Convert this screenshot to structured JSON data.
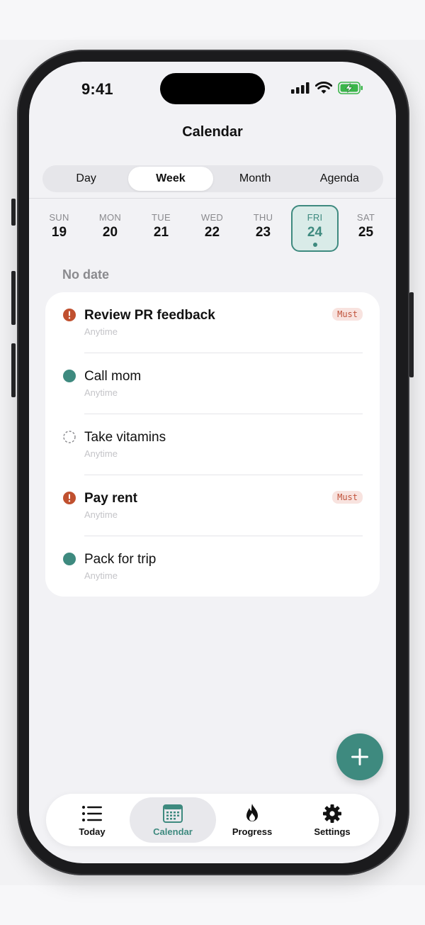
{
  "status_bar": {
    "time": "9:41"
  },
  "header": {
    "title": "Calendar"
  },
  "view_switcher": {
    "options": [
      "Day",
      "Week",
      "Month",
      "Agenda"
    ],
    "selected": "Week"
  },
  "week": {
    "days": [
      {
        "dow": "SUN",
        "num": "19"
      },
      {
        "dow": "MON",
        "num": "20"
      },
      {
        "dow": "TUE",
        "num": "21"
      },
      {
        "dow": "WED",
        "num": "22"
      },
      {
        "dow": "THU",
        "num": "23"
      },
      {
        "dow": "FRI",
        "num": "24"
      },
      {
        "dow": "SAT",
        "num": "25"
      }
    ],
    "selected_index": 5
  },
  "section": {
    "label": "No date"
  },
  "tasks": [
    {
      "title": "Review PR feedback",
      "subtitle": "Anytime",
      "badge": "Must",
      "icon": "alert-icon"
    },
    {
      "title": "Call mom",
      "subtitle": "Anytime",
      "badge": "",
      "icon": "filled-circle-icon"
    },
    {
      "title": "Take vitamins",
      "subtitle": "Anytime",
      "badge": "",
      "icon": "dashed-circle-icon"
    },
    {
      "title": "Pay rent",
      "subtitle": "Anytime",
      "badge": "Must",
      "icon": "alert-icon"
    },
    {
      "title": "Pack for trip",
      "subtitle": "Anytime",
      "badge": "",
      "icon": "filled-circle-icon"
    }
  ],
  "tab_bar": {
    "items": [
      {
        "label": "Today",
        "icon": "list-icon"
      },
      {
        "label": "Calendar",
        "icon": "calendar-icon"
      },
      {
        "label": "Progress",
        "icon": "flame-icon"
      },
      {
        "label": "Settings",
        "icon": "gear-icon"
      }
    ],
    "selected": "Calendar"
  },
  "colors": {
    "accent": "#3e8a7f",
    "must_text": "#c0533b",
    "must_bg": "#f8e3df",
    "alert": "#c0502f"
  }
}
